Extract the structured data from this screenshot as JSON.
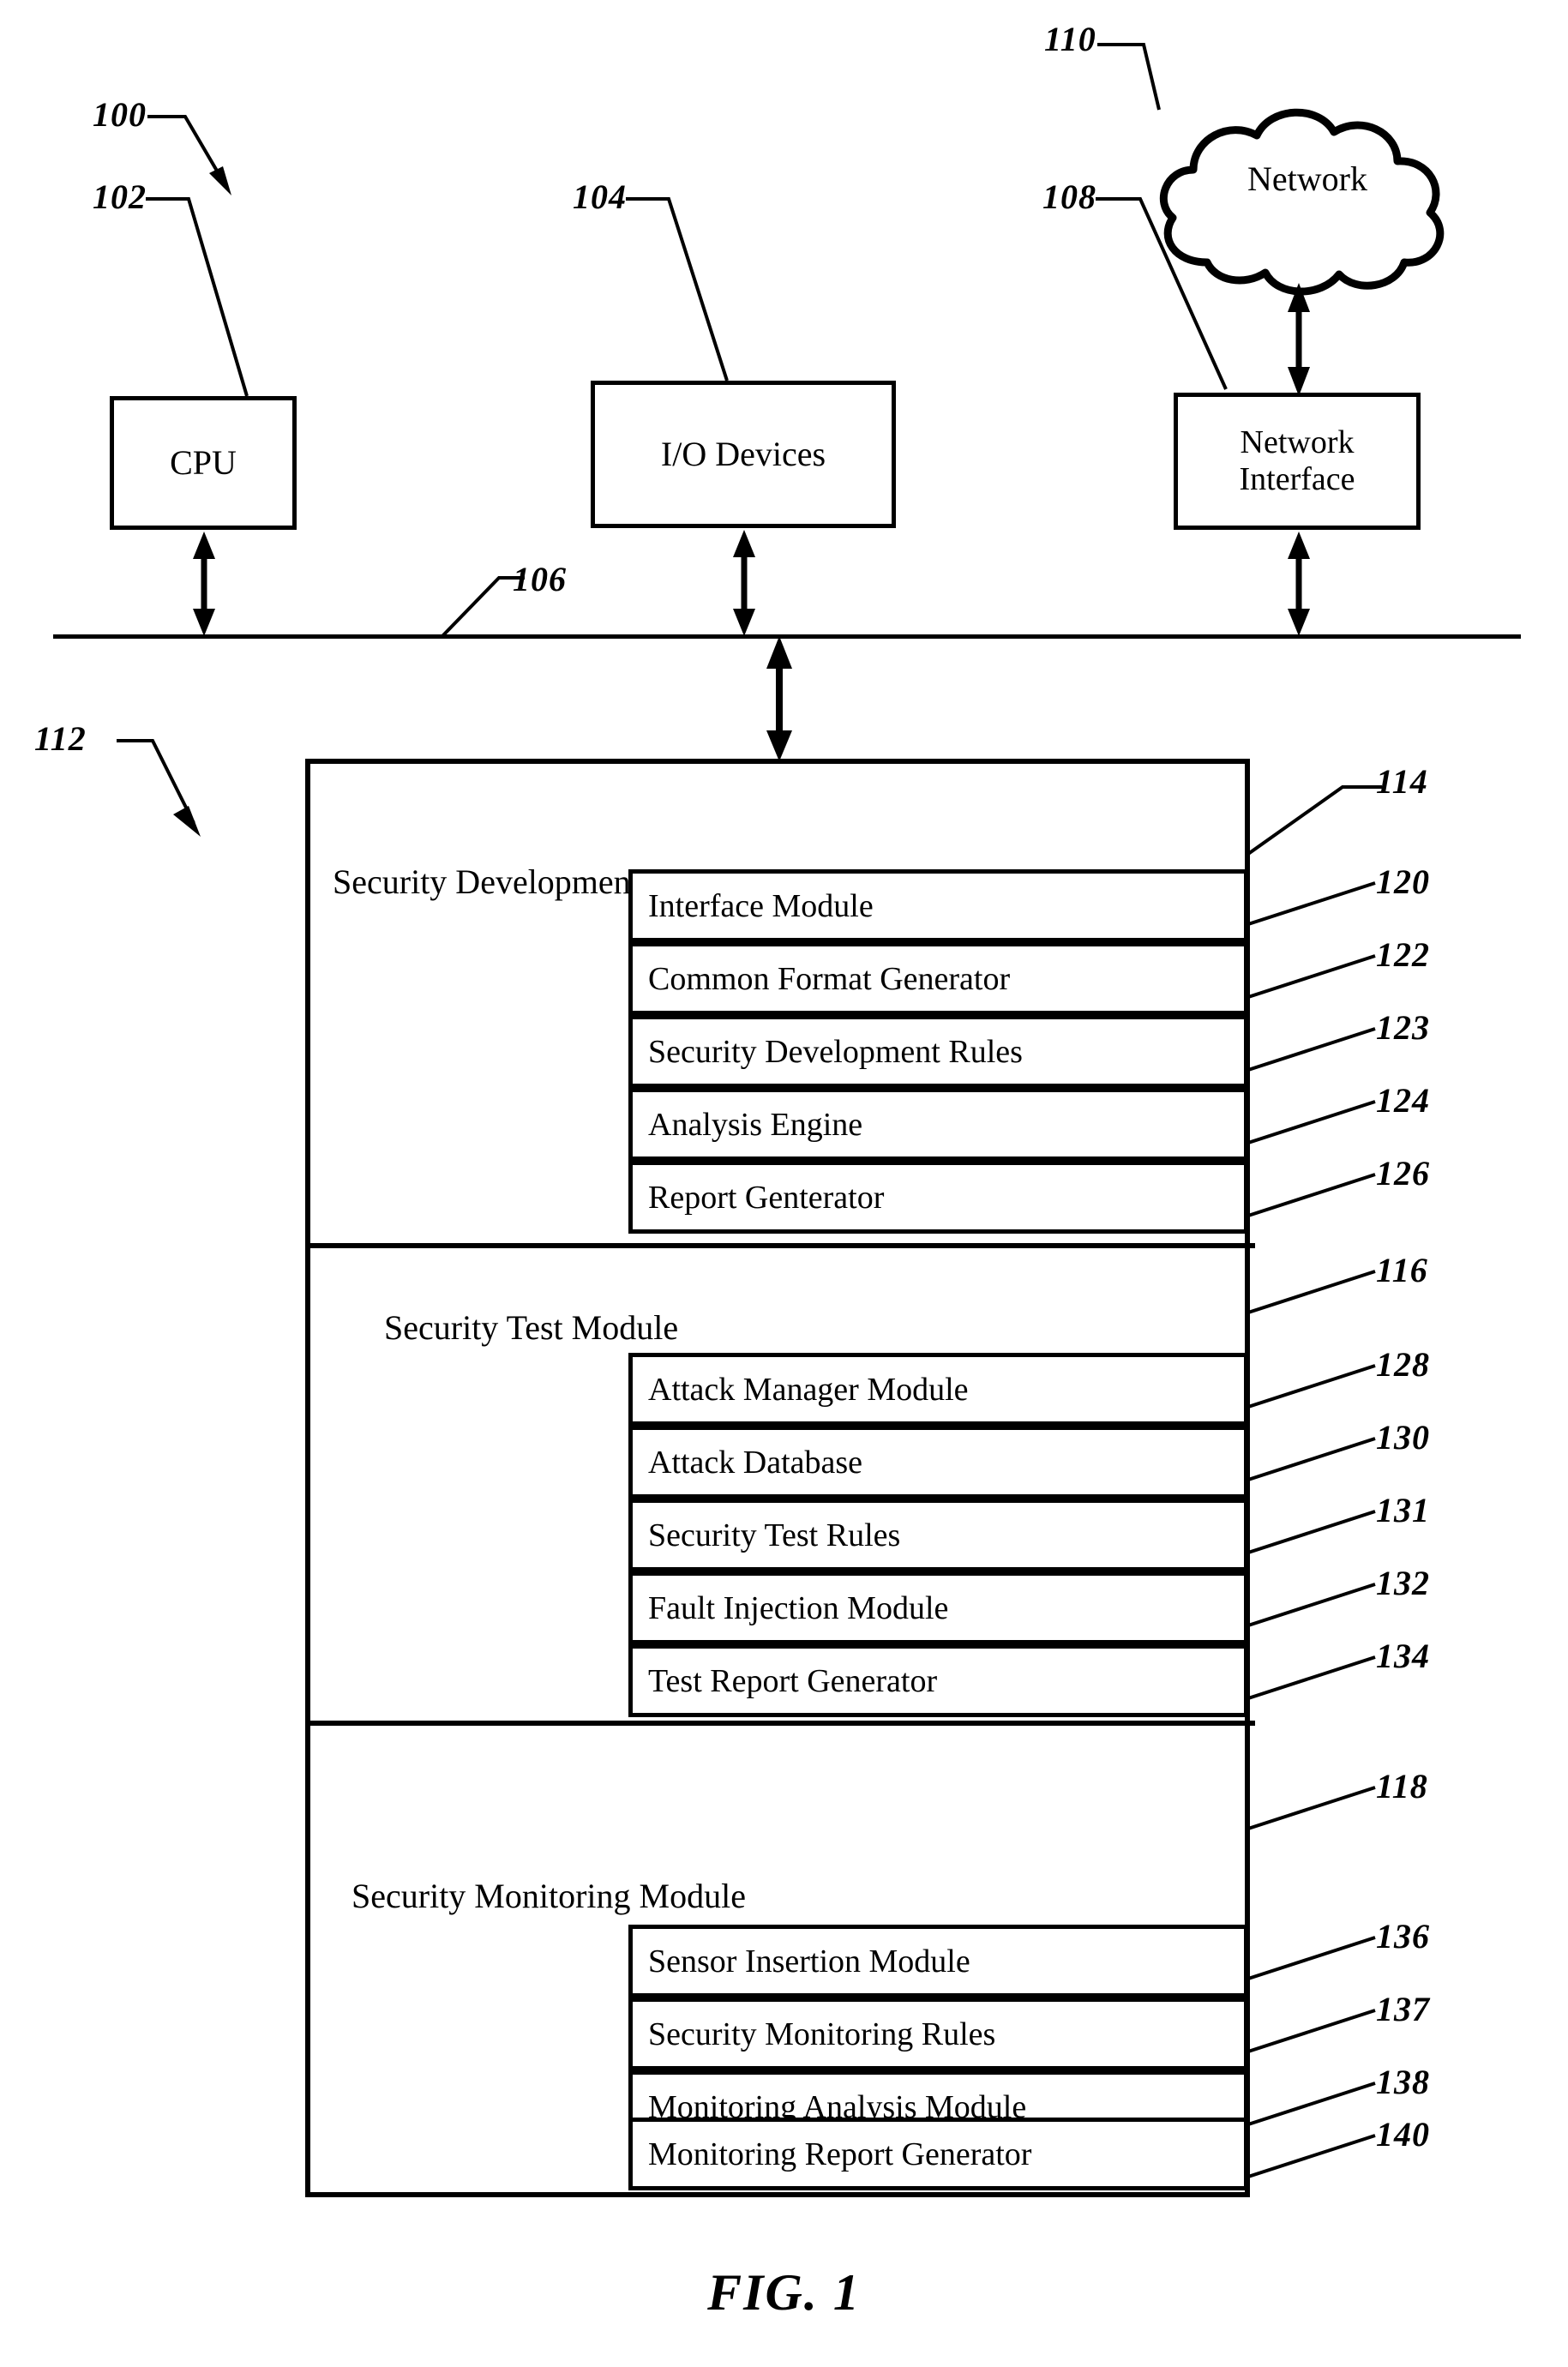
{
  "figure": {
    "caption": "FIG. 1",
    "system_ref": "100",
    "bus_ref": "106",
    "software_ref": "112"
  },
  "hardware": {
    "cpu": {
      "label": "CPU",
      "ref": "102"
    },
    "io": {
      "label": "I/O Devices",
      "ref": "104"
    },
    "network_interface": {
      "label_line1": "Network",
      "label_line2": "Interface",
      "ref": "108"
    },
    "network_cloud": {
      "label": "Network",
      "ref": "110"
    }
  },
  "modules": [
    {
      "title": "Security Development Module",
      "ref": "114",
      "rows": [
        {
          "label": "Interface Module",
          "ref": "120"
        },
        {
          "label": "Common Format Generator",
          "ref": "122"
        },
        {
          "label": "Security Development Rules",
          "ref": "123"
        },
        {
          "label": "Analysis Engine",
          "ref": "124"
        },
        {
          "label": "Report Genterator",
          "ref": "126"
        }
      ]
    },
    {
      "title": "Security Test Module",
      "ref": "116",
      "rows": [
        {
          "label": "Attack Manager Module",
          "ref": "128"
        },
        {
          "label": "Attack Database",
          "ref": "130"
        },
        {
          "label": "Security Test Rules",
          "ref": "131"
        },
        {
          "label": "Fault Injection Module",
          "ref": "132"
        },
        {
          "label": "Test Report Generator",
          "ref": "134"
        }
      ]
    },
    {
      "title": "Security Monitoring Module",
      "ref": "118",
      "rows": [
        {
          "label": "Sensor Insertion Module",
          "ref": "136"
        },
        {
          "label": "Security Monitoring Rules",
          "ref": "137"
        },
        {
          "label": "Monitoring Analysis Module",
          "ref": "138"
        },
        {
          "label": "Monitoring Report Generator",
          "ref": "140"
        }
      ]
    }
  ],
  "colors": {
    "ink": "#000000",
    "paper": "#ffffff"
  }
}
